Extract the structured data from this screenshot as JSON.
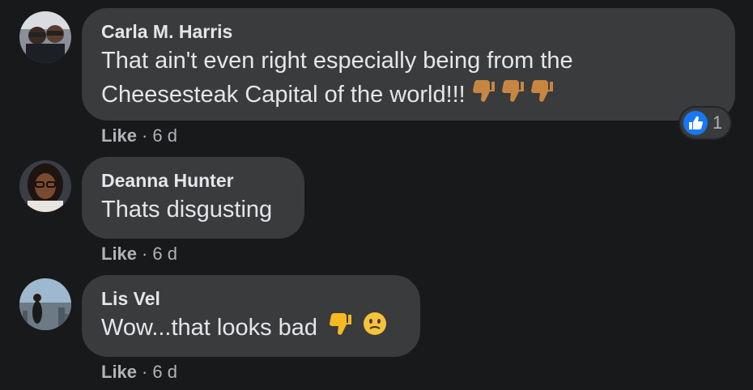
{
  "comments": [
    {
      "author": "Carla M. Harris",
      "text_line1": "That ain't even right especially being from the",
      "text_line2": "Cheesesteak Capital of the world!!!",
      "emojis": [
        "thumbs-down-icon",
        "thumbs-down-icon",
        "thumbs-down-icon"
      ],
      "like_label": "Like",
      "separator": "·",
      "time": "6 d",
      "reaction_count": "1",
      "reaction_icon": "like-icon"
    },
    {
      "author": "Deanna Hunter",
      "text": "Thats disgusting",
      "like_label": "Like",
      "separator": "·",
      "time": "6 d"
    },
    {
      "author": "Lis Vel",
      "text": "Wow...that looks bad",
      "emojis": [
        "thumbs-down-icon",
        "confused-face-icon"
      ],
      "like_label": "Like",
      "separator": "·",
      "time": "6 d"
    }
  ],
  "colors": {
    "background": "#18191a",
    "bubble": "#3a3b3c",
    "text": "#e4e6eb",
    "secondary_text": "#b0b3b8",
    "like_blue": "#1877f2"
  }
}
